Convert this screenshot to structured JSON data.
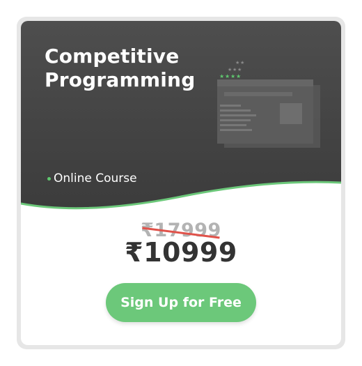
{
  "course": {
    "title_line1": "Competitive",
    "title_line2": "Programming",
    "type": "Online Course"
  },
  "pricing": {
    "original_price": "₹17999",
    "current_price": "₹10999"
  },
  "cta": {
    "label": "Sign Up for Free"
  },
  "icons": {
    "illustration": "course-screen-illustration-icon",
    "stars": "stars-icon",
    "bullet": "bullet-dot-icon"
  },
  "colors": {
    "hero_background": "#4a4a4a",
    "accent_green": "#6cc87a",
    "strike_red": "#e0524a",
    "price_text": "#333333",
    "old_price_text": "#b3b3b3"
  }
}
